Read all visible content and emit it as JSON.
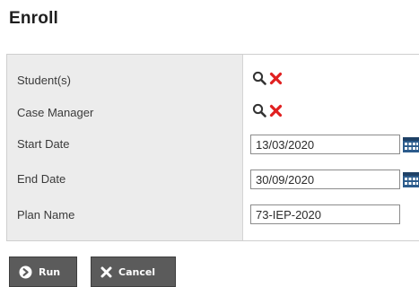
{
  "dialog": {
    "title": "Enroll"
  },
  "form": {
    "rows": [
      {
        "label": "Student(s)"
      },
      {
        "label": "Case Manager"
      },
      {
        "label": "Start Date",
        "value": "13/03/2020"
      },
      {
        "label": "End Date",
        "value": "30/09/2020"
      },
      {
        "label": "Plan Name",
        "value": "73-IEP-2020"
      }
    ],
    "icons": {
      "search": "magnifier-icon",
      "remove": "red-x-icon",
      "calendar": "calendar-icon"
    }
  },
  "buttons": {
    "run_label": "Run",
    "cancel_label": "Cancel"
  },
  "colors": {
    "label_background": "#ececec",
    "remove_red": "#e02020",
    "calendar_blue": "#2c5c8c",
    "button_gray": "#5b5b5b"
  }
}
